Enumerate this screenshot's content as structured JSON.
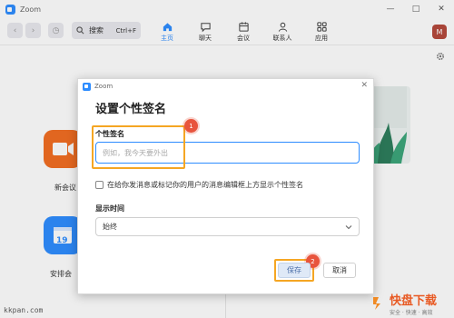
{
  "window": {
    "app_title": "Zoom",
    "minimize": "—",
    "maximize": "□",
    "close": "✕"
  },
  "toolbar": {
    "back": "‹",
    "forward": "›",
    "history": "◷",
    "search_label": "搜索",
    "search_shortcut": "Ctrl+F",
    "tabs": [
      {
        "label": "主页",
        "icon": "home-icon",
        "active": true
      },
      {
        "label": "聊天",
        "icon": "chat-icon",
        "active": false
      },
      {
        "label": "会议",
        "icon": "calendar-icon",
        "active": false
      },
      {
        "label": "联系人",
        "icon": "contacts-icon",
        "active": false
      },
      {
        "label": "应用",
        "icon": "apps-icon",
        "active": false
      }
    ],
    "avatar_initial": "M"
  },
  "home": {
    "tiles": [
      {
        "label": "新会议",
        "visible_label": "新会议",
        "color": "#f26d21",
        "icon": "video-camera-icon"
      },
      {
        "label": "安排会议",
        "visible_label": "安排会",
        "color": "#2d8cff",
        "icon": "calendar-icon",
        "icon_text": "19"
      }
    ]
  },
  "dialog": {
    "app_title": "Zoom",
    "close": "✕",
    "heading": "设置个性签名",
    "signature_label": "个性签名",
    "signature_placeholder": "例如，我今天要外出",
    "checkbox_label": "在给你发消息或标记你的用户的消息编辑框上方显示个性签名",
    "checkbox_checked": false,
    "display_time_label": "显示时间",
    "display_time_value": "始终",
    "save_label": "保存",
    "cancel_label": "取消",
    "annotation_1": "1",
    "annotation_2": "2",
    "annotation_color": "#e8543d",
    "highlight_color": "#f5a623"
  },
  "watermarks": {
    "left": "kkpan.com",
    "right_main": "快盘下载",
    "right_sub": "安全 · 快速 · 高效"
  },
  "colors": {
    "accent": "#2d8cff",
    "orange_tile": "#f26d21"
  }
}
